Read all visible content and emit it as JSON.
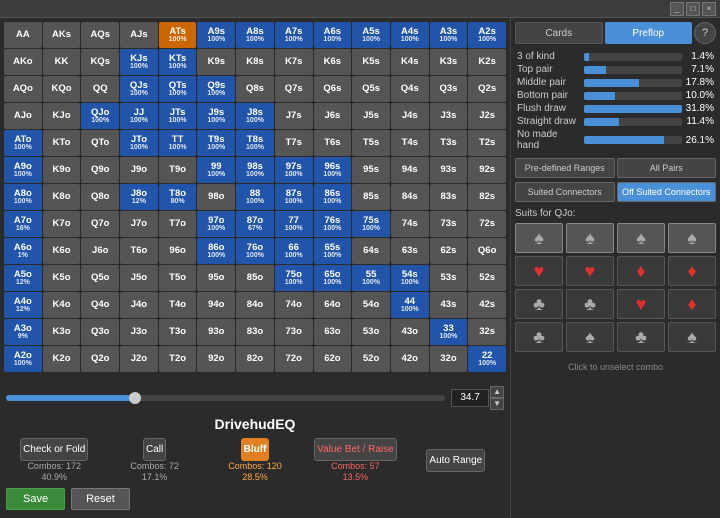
{
  "titleBar": {
    "buttons": [
      "_",
      "□",
      "×"
    ]
  },
  "tabs": {
    "cards": "Cards",
    "preflop": "Preflop"
  },
  "stats": [
    {
      "label": "3 of kind",
      "value": "1.4%",
      "bar": 5
    },
    {
      "label": "Top pair",
      "value": "7.1%",
      "bar": 22
    },
    {
      "label": "Middle pair",
      "value": "17.8%",
      "bar": 55
    },
    {
      "label": "Bottom pair",
      "value": "10.0%",
      "bar": 31
    },
    {
      "label": "Flush draw",
      "value": "31.8%",
      "bar": 98
    },
    {
      "label": "Straight draw",
      "value": "11.4%",
      "bar": 35
    },
    {
      "label": "No made hand",
      "value": "26.1%",
      "bar": 80
    }
  ],
  "rangeButtons": {
    "predefined": "Pre-defined Ranges",
    "allPairs": "All Pairs"
  },
  "connectorButtons": {
    "suited": "Suited Connectors",
    "offSuited": "Off Suited Connectors"
  },
  "suitsLabel": "Suits for QJo:",
  "clickUnselect": "Click to unselect combo",
  "slider": {
    "value": "34.7"
  },
  "rangeTitle": "DrivehudEQ",
  "actions": {
    "checkOrFold": {
      "label": "Check or Fold",
      "combos": "Combos: 172",
      "pct": "40.9%"
    },
    "call": {
      "label": "Call",
      "combos": "Combos: 72",
      "pct": "17.1%"
    },
    "bluff": {
      "label": "Bluff",
      "combos": "Combos: 120",
      "pct": "28.5%"
    },
    "valueBet": {
      "label": "Value Bet / Raise",
      "combos": "Combos: 57",
      "pct": "13.5%"
    },
    "autoRange": "Auto Range"
  },
  "saveBtn": "Save",
  "resetBtn": "Reset",
  "cells": [
    [
      {
        "label": "AA",
        "color": "gray"
      },
      {
        "label": "AKs",
        "color": "gray"
      },
      {
        "label": "AQs",
        "color": "gray"
      },
      {
        "label": "AJs",
        "color": "gray"
      },
      {
        "label": "ATs",
        "color": "orange",
        "pct": "100%"
      },
      {
        "label": "A9s",
        "color": "blue",
        "pct": "100%"
      },
      {
        "label": "A8s",
        "color": "blue",
        "pct": "100%"
      },
      {
        "label": "A7s",
        "color": "blue",
        "pct": "100%"
      },
      {
        "label": "A6s",
        "color": "blue",
        "pct": "100%"
      },
      {
        "label": "A5s",
        "color": "blue",
        "pct": "100%"
      },
      {
        "label": "A4s",
        "color": "blue",
        "pct": "100%"
      },
      {
        "label": "A3s",
        "color": "blue",
        "pct": "100%"
      },
      {
        "label": "A2s",
        "color": "blue",
        "pct": "100%"
      }
    ],
    [
      {
        "label": "AKo",
        "color": "gray"
      },
      {
        "label": "KK",
        "color": "gray"
      },
      {
        "label": "KQs",
        "color": "gray"
      },
      {
        "label": "KJs",
        "color": "blue",
        "pct": "100%"
      },
      {
        "label": "KTs",
        "color": "blue",
        "pct": "100%"
      },
      {
        "label": "K9s",
        "color": "gray"
      },
      {
        "label": "K8s",
        "color": "gray"
      },
      {
        "label": "K7s",
        "color": "gray"
      },
      {
        "label": "K6s",
        "color": "gray"
      },
      {
        "label": "K5s",
        "color": "gray"
      },
      {
        "label": "K4s",
        "color": "gray"
      },
      {
        "label": "K3s",
        "color": "gray"
      },
      {
        "label": "K2s",
        "color": "gray"
      }
    ],
    [
      {
        "label": "AQo",
        "color": "gray"
      },
      {
        "label": "KQo",
        "color": "gray"
      },
      {
        "label": "QQ",
        "color": "gray"
      },
      {
        "label": "QJs",
        "color": "blue",
        "pct": "100%"
      },
      {
        "label": "QTs",
        "color": "blue",
        "pct": "100%"
      },
      {
        "label": "Q9s",
        "color": "blue",
        "pct": "100%"
      },
      {
        "label": "Q8s",
        "color": "gray"
      },
      {
        "label": "Q7s",
        "color": "gray"
      },
      {
        "label": "Q6s",
        "color": "gray"
      },
      {
        "label": "Q5s",
        "color": "gray"
      },
      {
        "label": "Q4s",
        "color": "gray"
      },
      {
        "label": "Q3s",
        "color": "gray"
      },
      {
        "label": "Q2s",
        "color": "gray"
      }
    ],
    [
      {
        "label": "AJo",
        "color": "gray"
      },
      {
        "label": "KJo",
        "color": "gray"
      },
      {
        "label": "QJo",
        "color": "blue",
        "pct": "100%"
      },
      {
        "label": "JJ",
        "color": "blue",
        "pct": "100%"
      },
      {
        "label": "JTs",
        "color": "blue",
        "pct": "100%"
      },
      {
        "label": "J9s",
        "color": "blue",
        "pct": "100%"
      },
      {
        "label": "J8s",
        "color": "blue",
        "pct": "100%"
      },
      {
        "label": "J7s",
        "color": "gray"
      },
      {
        "label": "J6s",
        "color": "gray"
      },
      {
        "label": "J5s",
        "color": "gray"
      },
      {
        "label": "J4s",
        "color": "gray"
      },
      {
        "label": "J3s",
        "color": "gray"
      },
      {
        "label": "J2s",
        "color": "gray"
      }
    ],
    [
      {
        "label": "ATo",
        "color": "blue",
        "pct": "100%"
      },
      {
        "label": "KTo",
        "color": "gray"
      },
      {
        "label": "QTo",
        "color": "gray"
      },
      {
        "label": "JTo",
        "color": "blue",
        "pct": "100%"
      },
      {
        "label": "TT",
        "color": "blue",
        "pct": "100%"
      },
      {
        "label": "T9s",
        "color": "blue",
        "pct": "100%"
      },
      {
        "label": "T8s",
        "color": "blue",
        "pct": "100%"
      },
      {
        "label": "T7s",
        "color": "gray"
      },
      {
        "label": "T6s",
        "color": "gray"
      },
      {
        "label": "T5s",
        "color": "gray"
      },
      {
        "label": "T4s",
        "color": "gray"
      },
      {
        "label": "T3s",
        "color": "gray"
      },
      {
        "label": "T2s",
        "color": "gray"
      }
    ],
    [
      {
        "label": "A9o",
        "color": "blue",
        "pct": "100%"
      },
      {
        "label": "K9o",
        "color": "gray"
      },
      {
        "label": "Q9o",
        "color": "gray"
      },
      {
        "label": "J9o",
        "color": "gray"
      },
      {
        "label": "T9o",
        "color": "gray"
      },
      {
        "label": "99",
        "color": "blue",
        "pct": "100%"
      },
      {
        "label": "98s",
        "color": "blue",
        "pct": "100%"
      },
      {
        "label": "97s",
        "color": "blue",
        "pct": "100%"
      },
      {
        "label": "96s",
        "color": "blue",
        "pct": "100%"
      },
      {
        "label": "95s",
        "color": "gray"
      },
      {
        "label": "94s",
        "color": "gray"
      },
      {
        "label": "93s",
        "color": "gray"
      },
      {
        "label": "92s",
        "color": "gray"
      }
    ],
    [
      {
        "label": "A8o",
        "color": "blue",
        "pct": "100%"
      },
      {
        "label": "K8o",
        "color": "gray"
      },
      {
        "label": "Q8o",
        "color": "gray"
      },
      {
        "label": "J8o",
        "color": "blue",
        "pct": "12%"
      },
      {
        "label": "T8o",
        "color": "blue",
        "pct": "80%"
      },
      {
        "label": "98o",
        "color": "gray"
      },
      {
        "label": "88",
        "color": "blue",
        "pct": "100%"
      },
      {
        "label": "87s",
        "color": "blue",
        "pct": "100%"
      },
      {
        "label": "86s",
        "color": "blue",
        "pct": "100%"
      },
      {
        "label": "85s",
        "color": "gray"
      },
      {
        "label": "84s",
        "color": "gray"
      },
      {
        "label": "83s",
        "color": "gray"
      },
      {
        "label": "82s",
        "color": "gray"
      }
    ],
    [
      {
        "label": "A7o",
        "color": "blue",
        "pct": "16%"
      },
      {
        "label": "K7o",
        "color": "gray"
      },
      {
        "label": "Q7o",
        "color": "gray"
      },
      {
        "label": "J7o",
        "color": "gray"
      },
      {
        "label": "T7o",
        "color": "gray"
      },
      {
        "label": "97o",
        "color": "blue",
        "pct": "100%"
      },
      {
        "label": "87o",
        "color": "blue",
        "pct": "67%"
      },
      {
        "label": "77",
        "color": "blue",
        "pct": "100%"
      },
      {
        "label": "76s",
        "color": "blue",
        "pct": "100%"
      },
      {
        "label": "75s",
        "color": "blue",
        "pct": "100%"
      },
      {
        "label": "74s",
        "color": "gray"
      },
      {
        "label": "73s",
        "color": "gray"
      },
      {
        "label": "72s",
        "color": "gray"
      }
    ],
    [
      {
        "label": "A6o",
        "color": "blue",
        "pct": "1%"
      },
      {
        "label": "K6o",
        "color": "gray"
      },
      {
        "label": "J6o",
        "color": "gray"
      },
      {
        "label": "T6o",
        "color": "gray"
      },
      {
        "label": "96o",
        "color": "gray"
      },
      {
        "label": "86o",
        "color": "blue",
        "pct": "100%"
      },
      {
        "label": "76o",
        "color": "blue",
        "pct": "100%"
      },
      {
        "label": "66",
        "color": "blue",
        "pct": "100%"
      },
      {
        "label": "65s",
        "color": "blue",
        "pct": "100%"
      },
      {
        "label": "64s",
        "color": "gray"
      },
      {
        "label": "63s",
        "color": "gray"
      },
      {
        "label": "62s",
        "color": "gray"
      },
      {
        "label": "Q6o",
        "color": "gray"
      }
    ],
    [
      {
        "label": "A5o",
        "color": "blue",
        "pct": "12%"
      },
      {
        "label": "K5o",
        "color": "gray"
      },
      {
        "label": "Q5o",
        "color": "gray"
      },
      {
        "label": "J5o",
        "color": "gray"
      },
      {
        "label": "T5o",
        "color": "gray"
      },
      {
        "label": "95o",
        "color": "gray"
      },
      {
        "label": "85o",
        "color": "gray"
      },
      {
        "label": "75o",
        "color": "blue",
        "pct": "100%"
      },
      {
        "label": "65o",
        "color": "blue",
        "pct": "100%"
      },
      {
        "label": "55",
        "color": "blue",
        "pct": "100%"
      },
      {
        "label": "54s",
        "color": "blue",
        "pct": "100%"
      },
      {
        "label": "53s",
        "color": "gray"
      },
      {
        "label": "52s",
        "color": "gray"
      }
    ],
    [
      {
        "label": "A4o",
        "color": "blue",
        "pct": "12%"
      },
      {
        "label": "K4o",
        "color": "gray"
      },
      {
        "label": "Q4o",
        "color": "gray"
      },
      {
        "label": "J4o",
        "color": "gray"
      },
      {
        "label": "T4o",
        "color": "gray"
      },
      {
        "label": "94o",
        "color": "gray"
      },
      {
        "label": "84o",
        "color": "gray"
      },
      {
        "label": "74o",
        "color": "gray"
      },
      {
        "label": "64o",
        "color": "gray"
      },
      {
        "label": "54o",
        "color": "gray"
      },
      {
        "label": "44",
        "color": "blue",
        "pct": "100%"
      },
      {
        "label": "43s",
        "color": "gray"
      },
      {
        "label": "42s",
        "color": "gray"
      }
    ],
    [
      {
        "label": "A3o",
        "color": "blue",
        "pct": "9%"
      },
      {
        "label": "K3o",
        "color": "gray"
      },
      {
        "label": "Q3o",
        "color": "gray"
      },
      {
        "label": "J3o",
        "color": "gray"
      },
      {
        "label": "T3o",
        "color": "gray"
      },
      {
        "label": "93o",
        "color": "gray"
      },
      {
        "label": "83o",
        "color": "gray"
      },
      {
        "label": "73o",
        "color": "gray"
      },
      {
        "label": "63o",
        "color": "gray"
      },
      {
        "label": "53o",
        "color": "gray"
      },
      {
        "label": "43o",
        "color": "gray"
      },
      {
        "label": "33",
        "color": "blue",
        "pct": "100%"
      },
      {
        "label": "32s",
        "color": "gray"
      }
    ],
    [
      {
        "label": "A2o",
        "color": "blue",
        "pct": "100%"
      },
      {
        "label": "K2o",
        "color": "gray"
      },
      {
        "label": "Q2o",
        "color": "gray"
      },
      {
        "label": "J2o",
        "color": "gray"
      },
      {
        "label": "T2o",
        "color": "gray"
      },
      {
        "label": "92o",
        "color": "gray"
      },
      {
        "label": "82o",
        "color": "gray"
      },
      {
        "label": "72o",
        "color": "gray"
      },
      {
        "label": "62o",
        "color": "gray"
      },
      {
        "label": "52o",
        "color": "gray"
      },
      {
        "label": "42o",
        "color": "gray"
      },
      {
        "label": "32o",
        "color": "gray"
      },
      {
        "label": "22",
        "color": "blue",
        "pct": "100%"
      }
    ]
  ],
  "suitsGrid": [
    [
      {
        "suit": "♠",
        "type": "black"
      },
      {
        "suit": "♠",
        "type": "black"
      },
      {
        "suit": "♠",
        "type": "black"
      },
      {
        "suit": "♠",
        "type": "black"
      }
    ],
    [
      {
        "suit": "♥",
        "type": "red"
      },
      {
        "suit": "♥",
        "type": "red"
      },
      {
        "suit": "♦",
        "type": "red"
      },
      {
        "suit": "♦",
        "type": "red"
      }
    ],
    [
      {
        "suit": "♣",
        "type": "black"
      },
      {
        "suit": "♣",
        "type": "black"
      },
      {
        "suit": "♥",
        "type": "red"
      },
      {
        "suit": "♦",
        "type": "red"
      }
    ],
    [
      {
        "suit": "♣",
        "type": "black"
      },
      {
        "suit": "♠",
        "type": "black"
      },
      {
        "suit": "♣",
        "type": "black"
      },
      {
        "suit": "♠",
        "type": "black"
      }
    ]
  ]
}
